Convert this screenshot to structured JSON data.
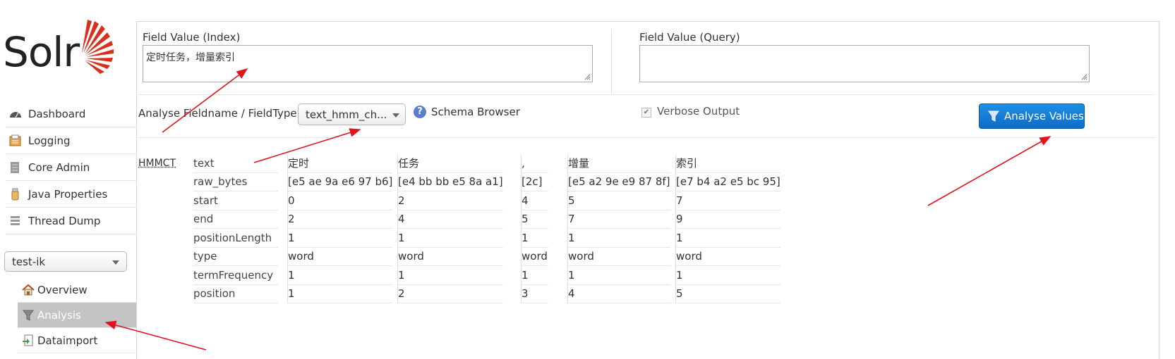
{
  "logo": {
    "text": "Solr"
  },
  "nav": [
    {
      "label": "Dashboard",
      "icon": "dashboard-icon"
    },
    {
      "label": "Logging",
      "icon": "logging-icon"
    },
    {
      "label": "Core Admin",
      "icon": "core-admin-icon"
    },
    {
      "label": "Java Properties",
      "icon": "java-properties-icon"
    },
    {
      "label": "Thread Dump",
      "icon": "thread-dump-icon"
    }
  ],
  "core_selector": {
    "value": "test-ik"
  },
  "core_nav": [
    {
      "label": "Overview",
      "icon": "home-icon"
    },
    {
      "label": "Analysis",
      "icon": "filter-icon",
      "active": true
    },
    {
      "label": "Dataimport",
      "icon": "dataimport-icon"
    }
  ],
  "analysis": {
    "field_value_index_label": "Field Value (Index)",
    "field_value_index": "定时任务，增量索引",
    "field_value_query_label": "Field Value (Query)",
    "field_value_query": "",
    "fieldtype_label": "Analyse Fieldname / FieldType:",
    "fieldtype_value": "text_hmm_ch...",
    "schema_browser": "Schema Browser",
    "verbose_label": "Verbose Output",
    "verbose_checked": true,
    "analyse_button": "Analyse Values"
  },
  "result": {
    "analyzer": "HMMCT",
    "keys": [
      "text",
      "raw_bytes",
      "start",
      "end",
      "positionLength",
      "type",
      "termFrequency",
      "position"
    ],
    "tokens": [
      {
        "text": "定时",
        "raw_bytes": "[e5 ae 9a e6 97 b6]",
        "start": "0",
        "end": "2",
        "positionLength": "1",
        "type": "word",
        "termFrequency": "1",
        "position": "1"
      },
      {
        "text": "任务",
        "raw_bytes": "[e4 bb bb e5 8a a1]",
        "start": "2",
        "end": "4",
        "positionLength": "1",
        "type": "word",
        "termFrequency": "1",
        "position": "2"
      },
      {
        "text": ",",
        "raw_bytes": "[2c]",
        "start": "4",
        "end": "5",
        "positionLength": "1",
        "type": "word",
        "termFrequency": "1",
        "position": "3"
      },
      {
        "text": "增量",
        "raw_bytes": "[e5 a2 9e e9 87 8f]",
        "start": "5",
        "end": "7",
        "positionLength": "1",
        "type": "word",
        "termFrequency": "1",
        "position": "4"
      },
      {
        "text": "索引",
        "raw_bytes": "[e7 b4 a2 e5 bc 95]",
        "start": "7",
        "end": "9",
        "positionLength": "1",
        "type": "word",
        "termFrequency": "1",
        "position": "5"
      }
    ]
  },
  "colors": {
    "accent": "#1a7fd8",
    "annotation_arrow": "#e0141c",
    "logo_red": "#d9301c"
  }
}
